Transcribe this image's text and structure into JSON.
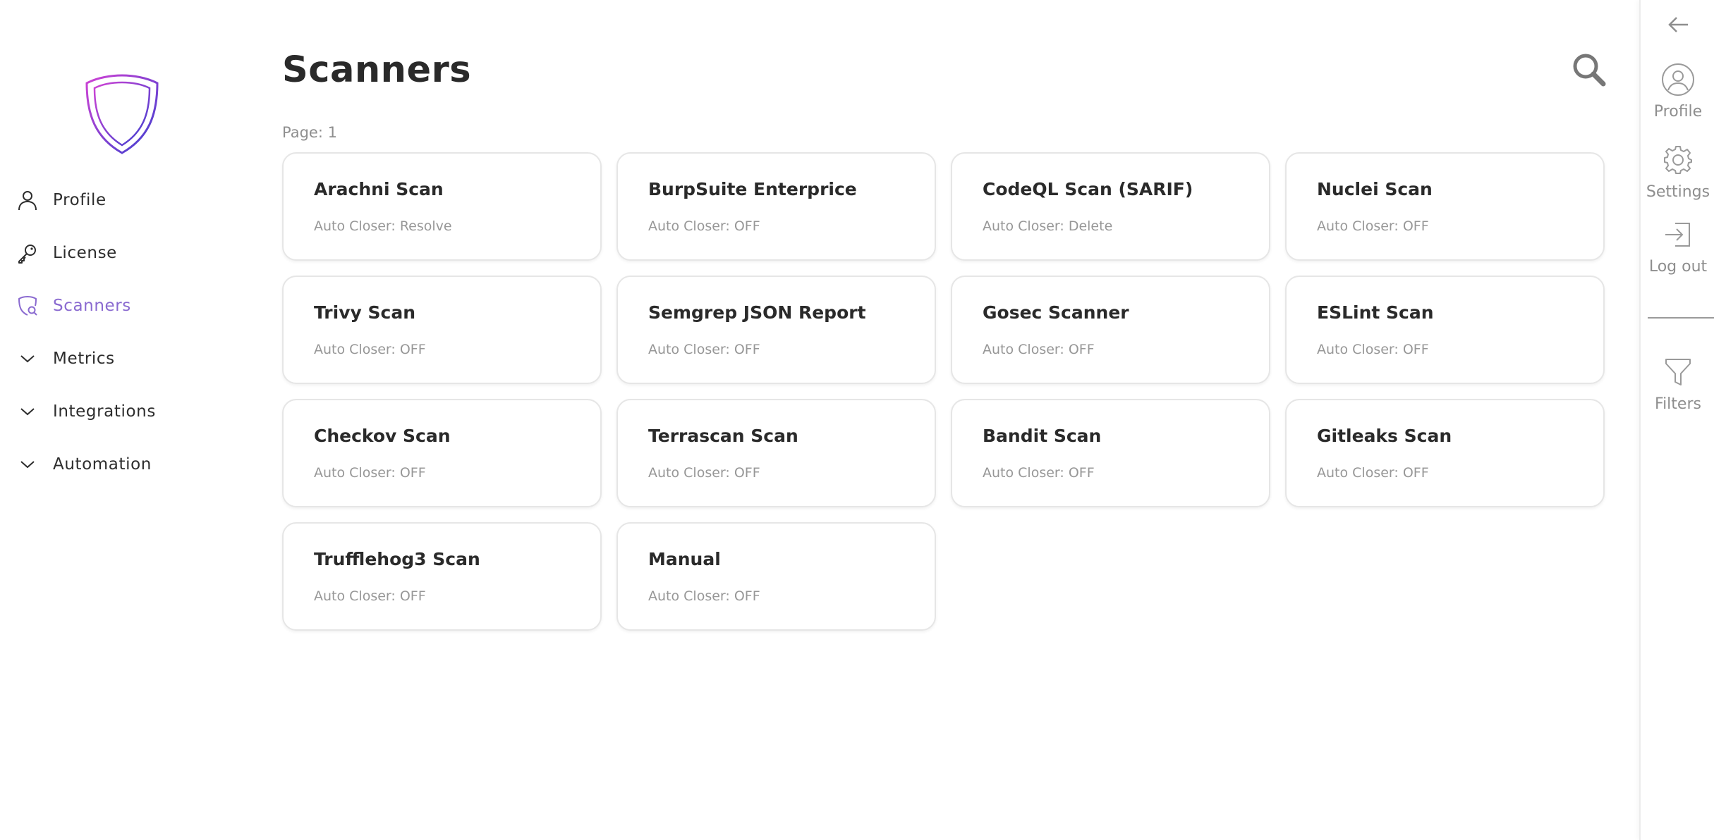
{
  "sidebar": {
    "items": [
      {
        "label": "Profile",
        "icon": "user-icon",
        "active": false
      },
      {
        "label": "License",
        "icon": "key-icon",
        "active": false
      },
      {
        "label": "Scanners",
        "icon": "shield-search-icon",
        "active": true
      },
      {
        "label": "Metrics",
        "icon": "chevron-down-icon",
        "active": false
      },
      {
        "label": "Integrations",
        "icon": "chevron-down-icon",
        "active": false
      },
      {
        "label": "Automation",
        "icon": "chevron-down-icon",
        "active": false
      }
    ]
  },
  "main": {
    "title": "Scanners",
    "page_info": "Page: 1",
    "cards": [
      {
        "name": "Arachni Scan",
        "sub": "Auto Closer: Resolve"
      },
      {
        "name": "BurpSuite Enterprice",
        "sub": "Auto Closer: OFF"
      },
      {
        "name": "CodeQL Scan (SARIF)",
        "sub": "Auto Closer: Delete"
      },
      {
        "name": "Nuclei Scan",
        "sub": "Auto Closer: OFF"
      },
      {
        "name": "Trivy Scan",
        "sub": "Auto Closer: OFF"
      },
      {
        "name": "Semgrep JSON Report",
        "sub": "Auto Closer: OFF"
      },
      {
        "name": "Gosec Scanner",
        "sub": "Auto Closer: OFF"
      },
      {
        "name": "ESLint Scan",
        "sub": "Auto Closer: OFF"
      },
      {
        "name": "Checkov Scan",
        "sub": "Auto Closer: OFF"
      },
      {
        "name": "Terrascan Scan",
        "sub": "Auto Closer: OFF"
      },
      {
        "name": "Bandit Scan",
        "sub": "Auto Closer: OFF"
      },
      {
        "name": "Gitleaks Scan",
        "sub": "Auto Closer: OFF"
      },
      {
        "name": "Trufflehog3 Scan",
        "sub": "Auto Closer: OFF"
      },
      {
        "name": "Manual",
        "sub": "Auto Closer: OFF"
      }
    ]
  },
  "rail": {
    "items": [
      {
        "label": "Profile",
        "icon": "user-circle-icon"
      },
      {
        "label": "Settings",
        "icon": "gear-icon"
      },
      {
        "label": "Log out",
        "icon": "logout-icon"
      },
      {
        "label": "Filters",
        "icon": "filter-icon"
      }
    ]
  },
  "colors": {
    "accent": "#8a6ad0",
    "logo_start": "#c33fd6",
    "logo_end": "#3b3fd0",
    "muted_text": "#979797"
  }
}
